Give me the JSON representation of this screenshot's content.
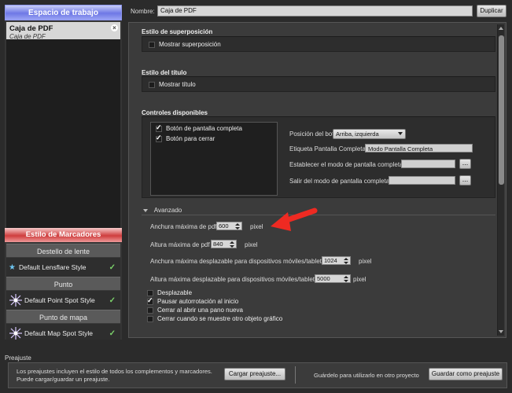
{
  "workspace": {
    "header": "Espacio de trabajo",
    "items": [
      {
        "title": "Caja de PDF",
        "subtitle": "Caja de PDF",
        "close_glyph": "×"
      }
    ]
  },
  "markers": {
    "header": "Estilo de Marcadores",
    "sections": [
      {
        "title": "Destello de lente",
        "item": "Default Lensflare Style",
        "icon": "star-icon"
      },
      {
        "title": "Punto",
        "item": "Default Point Spot Style",
        "icon": "burst-icon"
      },
      {
        "title": "Punto de mapa",
        "item": "Default Map Spot Style",
        "icon": "burst-icon"
      }
    ],
    "check_glyph": "✓"
  },
  "top": {
    "name_label": "Nombre:",
    "name_value": "Caja de PDF",
    "duplicate_label": "Duplicar"
  },
  "overlay": {
    "title": "Estilo de superposición",
    "checkbox_label": "Mostrar superposición",
    "checked": false
  },
  "title_style": {
    "title": "Estilo del título",
    "checkbox_label": "Mostrar título",
    "checked": false
  },
  "controls": {
    "title": "Controles disponibles",
    "items": [
      {
        "label": "Botón de pantalla completa",
        "checked": true
      },
      {
        "label": "Botón para cerrar",
        "checked": true
      }
    ],
    "position_label": "Posición del botón",
    "position_value": "Arriba, izquierda",
    "fullscreen_label": "Etiqueta Pantalla Completa",
    "fullscreen_value": "Modo Pantalla Completa",
    "set_fullscreen_label": "Establecer el modo de pantalla completa",
    "exit_fullscreen_label": "Salir del modo de pantalla completa",
    "dots": "..."
  },
  "advanced": {
    "title": "Avanzado",
    "max_width_label": "Anchura máxima de pdf",
    "max_width_value": "600",
    "max_height_label": "Altura máxima de pdf",
    "max_height_value": "840",
    "mobile_width_label": "Anchura máxima desplazable para dispositivos móviles/tabletas",
    "mobile_width_value": "1024",
    "mobile_height_label": "Altura máxima desplazable para dispositivos móviles/tabletas",
    "mobile_height_value": "5000",
    "unit": "pixel",
    "options": [
      {
        "label": "Desplazable",
        "checked": false
      },
      {
        "label": "Pausar autorrotación al inicio",
        "checked": true
      },
      {
        "label": "Cerrar al abrir una pano nueva",
        "checked": false
      },
      {
        "label": "Cerrar cuando se muestre otro objeto gráfico",
        "checked": false
      }
    ]
  },
  "presets": {
    "title": "Preajuste",
    "description": "Los preajustes incluyen el estilo de todos los complementos y marcadores. Puede cargar/guardar un preajuste.",
    "load_label": "Cargar preajuste...",
    "save_hint": "Guárdelo para utilizarlo en otro proyecto",
    "save_label": "Guardar como preajuste"
  },
  "colors": {
    "workspace_accent": "#6e78e6",
    "markers_accent": "#cf3d3d",
    "check_color": "#7cd36b",
    "arrow_color": "#ee2a22"
  }
}
